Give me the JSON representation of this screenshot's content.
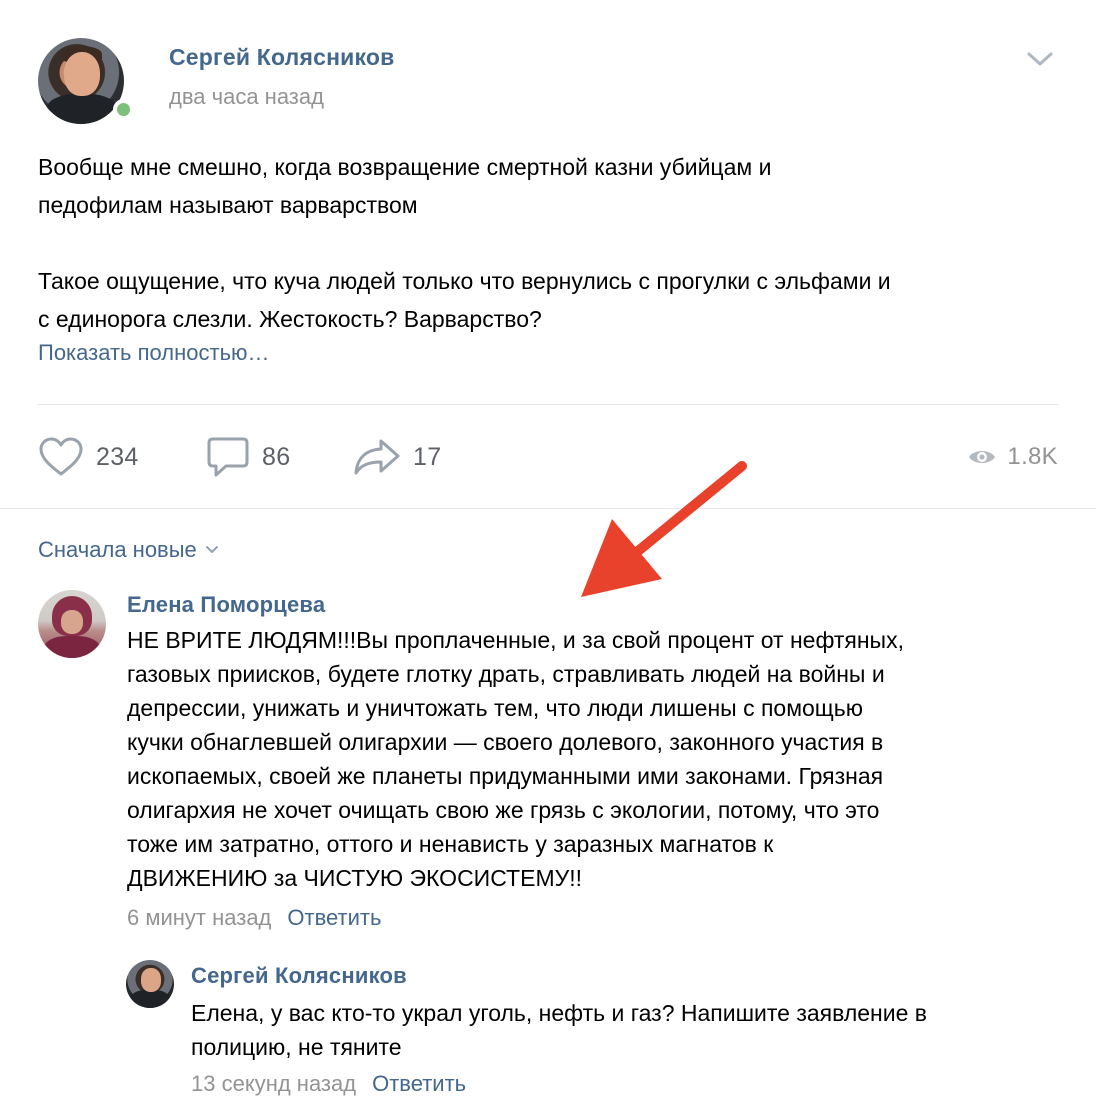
{
  "post": {
    "author": "Сергей Колясников",
    "time": "два часа назад",
    "paragraphs": [
      "Вообще мне смешно, когда возвращение смертной казни убийцам и\nпедофилам называют варварством",
      "Такое ощущение, что куча людей только что вернулись с прогулки с эльфами и\nс единорога слезли. Жестокость? Варварство?"
    ],
    "show_more": "Показать полностью…",
    "stats": {
      "likes": "234",
      "comments": "86",
      "shares": "17",
      "views": "1.8K"
    }
  },
  "comments_sort": "Сначала новые",
  "comments": [
    {
      "author": "Елена Поморцева",
      "text": "НЕ ВРИТЕ ЛЮДЯМ!!!Вы проплаченные, и за свой процент от нефтяных,\nгазовых приисков, будете глотку драть, стравливать людей на войны и\nдепрессии, унижать и уничтожать тем, что люди лишены с помощью\nкучки обнаглевшей олигархии — своего долевого, законного участия в\nископаемых, своей же планеты придуманными ими законами. Грязная\nолигархия не хочет очищать свою же грязь с экологии, потому, что это\nтоже им затратно, оттого и ненависть у заразных магнатов к\nДВИЖЕНИЮ за ЧИСТУЮ ЭКОСИСТЕМУ!!",
      "time": "6 минут назад",
      "reply_label": "Ответить"
    },
    {
      "author": "Сергей Колясников",
      "text": "Елена, у вас кто-то украл уголь, нефть и газ? Напишите заявление в\nполицию, не тяните",
      "time": "13 секунд назад",
      "reply_label": "Ответить"
    }
  ],
  "colors": {
    "link": "#44678e",
    "muted": "#939393",
    "online": "#7cc07b",
    "annotation_arrow": "#e8412c"
  },
  "icons": {
    "menu": "chevron-down-icon",
    "like": "heart-icon",
    "comment": "comment-bubble-icon",
    "share": "share-arrow-icon",
    "views": "eye-icon",
    "annotation": "red-arrow"
  }
}
